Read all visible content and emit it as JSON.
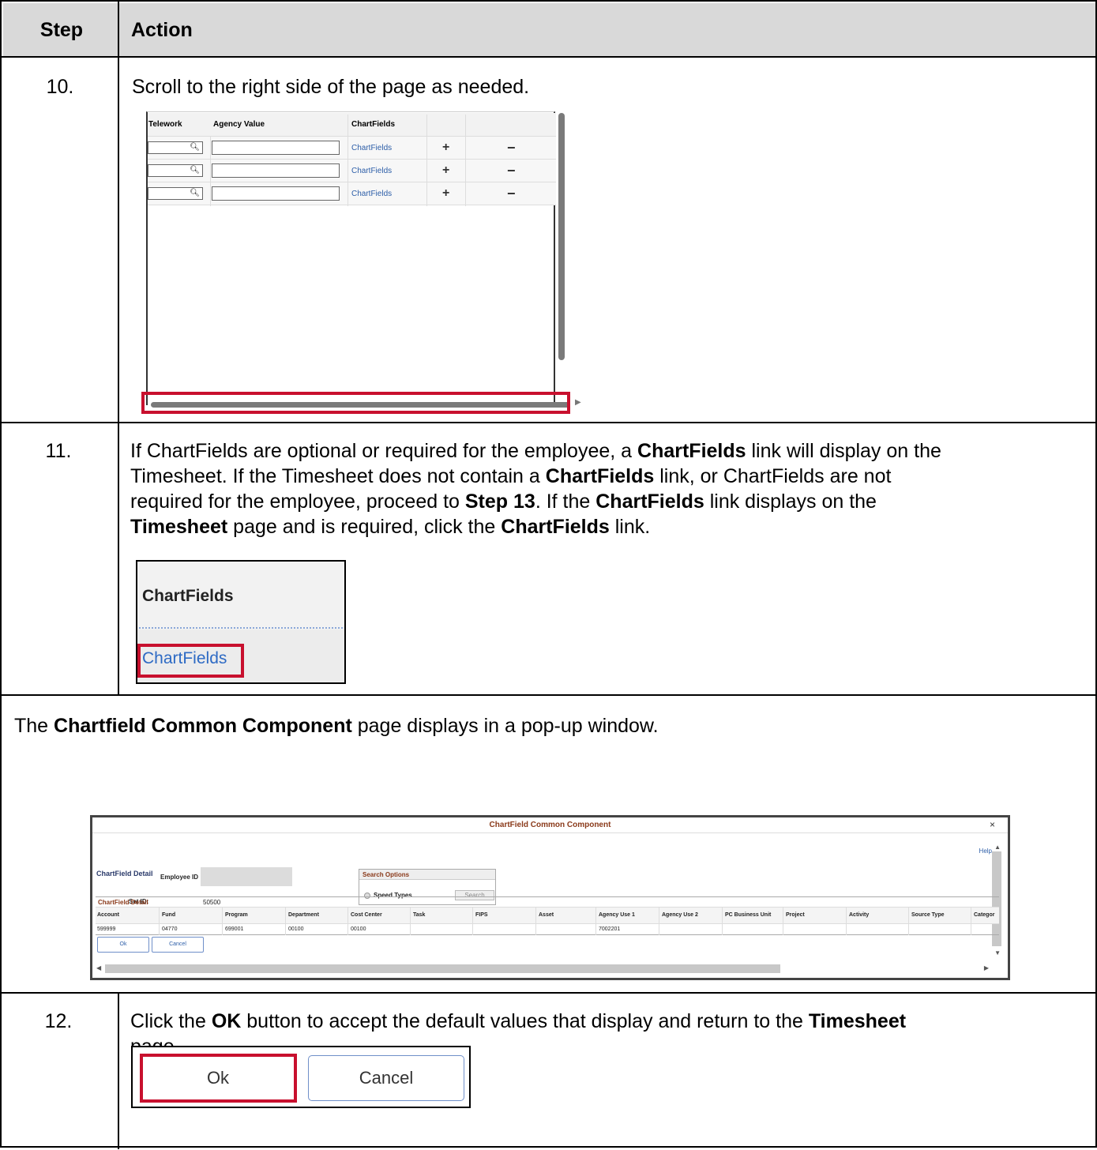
{
  "header": {
    "step": "Step",
    "action": "Action"
  },
  "step10": {
    "number": "10.",
    "text": "Scroll to the right side of the page as needed.",
    "screenshot": {
      "columns": [
        "Telework",
        "Agency Value",
        "ChartFields"
      ],
      "rows": [
        {
          "link": "ChartFields",
          "add": "+",
          "remove": "−"
        },
        {
          "link": "ChartFields",
          "add": "+",
          "remove": "−"
        },
        {
          "link": "ChartFields",
          "add": "+",
          "remove": "−"
        }
      ],
      "search_icon": "magnifier-icon"
    }
  },
  "step11": {
    "number": "11.",
    "t1": "If ChartFields are optional or required for the employee, a ",
    "b1": "ChartFields",
    "t2": " link will display on the",
    "t3": "Timesheet. If the Timesheet does not contain a ",
    "b2": "ChartFields",
    "t4": " link, or ChartFields are not",
    "t5": "required for the employee, proceed to ",
    "b3": "Step 13",
    "t6": ". If the ",
    "b4": "ChartFields",
    "t7": " link displays on the",
    "b5": "Timesheet",
    "t8": " page and is required, click the ",
    "b6": "ChartFields",
    "t9": " link.",
    "screenshot": {
      "title": "ChartFields",
      "link": "ChartFields"
    }
  },
  "note": {
    "t1": "The ",
    "b1": "Chartfield Common Component",
    "t2": " page displays in a pop-up window."
  },
  "popup": {
    "title": "ChartField Common Component",
    "close": "×",
    "help": "Help",
    "section": "ChartField Detail",
    "employee_id_label": "Employee ID",
    "setid_label": "Set ID:",
    "setid_value": "50500",
    "search_options": "Search Options",
    "speed_types": "Speed Types",
    "search_button": "Search",
    "grid_title": "ChartField Detail",
    "columns": [
      "Account",
      "Fund",
      "Program",
      "Department",
      "Cost Center",
      "Task",
      "FIPS",
      "Asset",
      "Agency Use 1",
      "Agency Use 2",
      "PC Business Unit",
      "Project",
      "Activity",
      "Source Type",
      "Categor"
    ],
    "values": [
      "599999",
      "04770",
      "699001",
      "00100",
      "00100",
      "",
      "",
      "",
      "7002201",
      "",
      "",
      "",
      "",
      "",
      ""
    ],
    "ok": "Ok",
    "cancel": "Cancel"
  },
  "step12": {
    "number": "12.",
    "t1": "Click the ",
    "b1": "OK",
    "t2": " button to accept the default values that display and return to the ",
    "b2": "Timesheet",
    "t3": "page.",
    "screenshot": {
      "ok": "Ok",
      "cancel": "Cancel"
    }
  },
  "colors": {
    "header_bg": "#d9d9d9",
    "highlight": "#c8102e",
    "link": "#2d5ea8"
  }
}
